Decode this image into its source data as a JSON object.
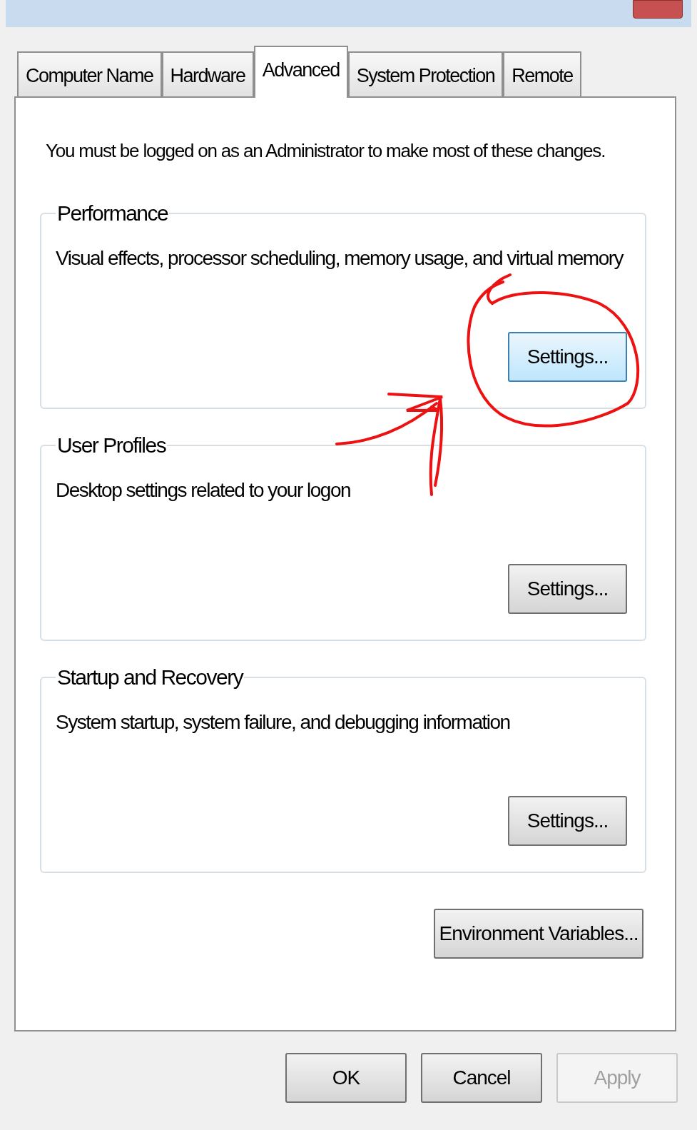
{
  "tabs": [
    {
      "label": "Computer Name",
      "selected": false
    },
    {
      "label": "Hardware",
      "selected": false
    },
    {
      "label": "Advanced",
      "selected": true
    },
    {
      "label": "System Protection",
      "selected": false
    },
    {
      "label": "Remote",
      "selected": false
    }
  ],
  "notice": "You must be logged on as an Administrator to make most of these changes.",
  "groups": [
    {
      "title": "Performance",
      "description": "Visual effects, processor scheduling, memory usage, and virtual memory",
      "button": {
        "label": "Settings...",
        "focused": true
      }
    },
    {
      "title": "User Profiles",
      "description": "Desktop settings related to your logon",
      "button": {
        "label": "Settings...",
        "focused": false
      }
    },
    {
      "title": "Startup and Recovery",
      "description": "System startup, system failure, and debugging information",
      "button": {
        "label": "Settings...",
        "focused": false
      }
    }
  ],
  "environment_button": "Environment Variables...",
  "buttons": [
    {
      "label": "OK",
      "disabled": false
    },
    {
      "label": "Cancel",
      "disabled": false
    },
    {
      "label": "Apply",
      "disabled": true
    }
  ]
}
